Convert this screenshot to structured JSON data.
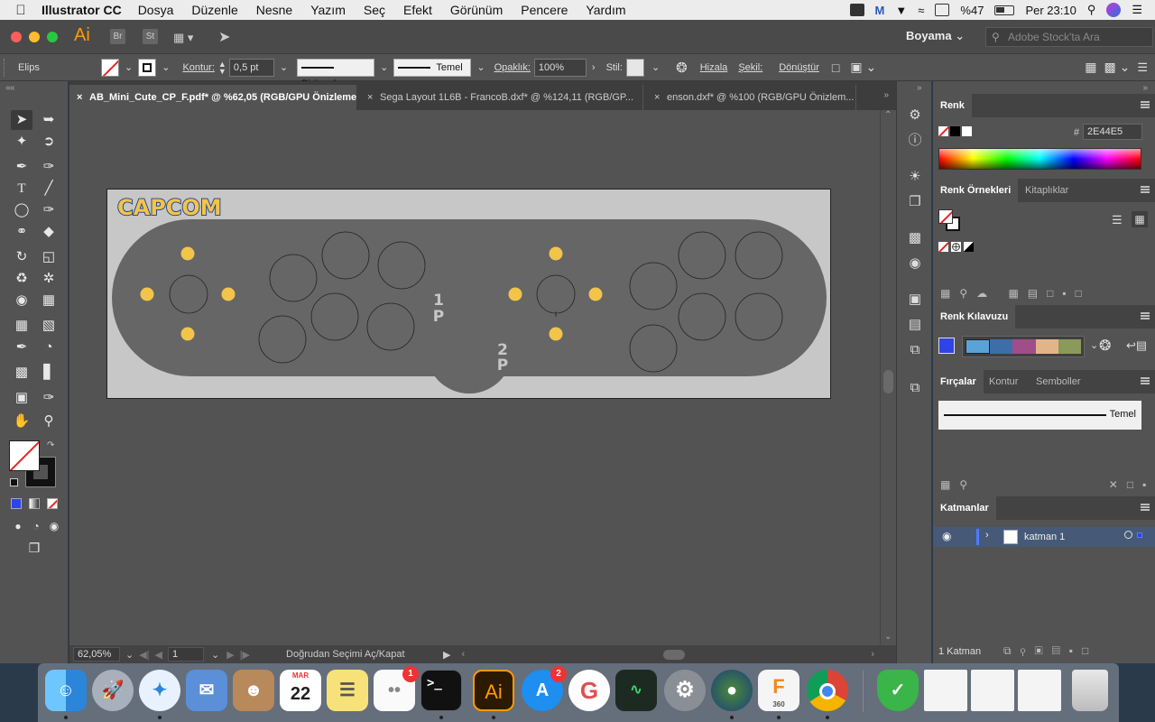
{
  "menubar": {
    "app_name": "Illustrator CC",
    "menus": [
      "Dosya",
      "Düzenle",
      "Nesne",
      "Yazım",
      "Seç",
      "Efekt",
      "Görünüm",
      "Pencere",
      "Yardım"
    ],
    "battery": "%47",
    "clock": "Per 23:10"
  },
  "appbar": {
    "logo": "Ai",
    "bridge_label": "Br",
    "stock_label": "St",
    "workspace": "Boyama",
    "stock_search_placeholder": "Adobe Stock'ta Ara"
  },
  "control": {
    "object_type": "Elips",
    "stroke_label": "Kontur:",
    "stroke_weight": "0,5 pt",
    "profile": "Birörnek",
    "brush": "Temel",
    "opacity_label": "Opaklık:",
    "opacity": "100%",
    "style_label": "Stil:",
    "align_label": "Hizala",
    "shape_label": "Şekil:",
    "transform_label": "Dönüştür"
  },
  "tabs": [
    {
      "label": "AB_Mini_Cute_CP_F.pdf* @ %62,05 (RGB/GPU Önizleme)",
      "close": "×"
    },
    {
      "label": "Sega Layout 1L6B - FrancoB.dxf* @ %124,11 (RGB/GP...",
      "close": "×"
    },
    {
      "label": "enson.dxf* @ %100 (RGB/GPU Önizlem...",
      "close": "×"
    }
  ],
  "artboard": {
    "logo_text": "CAPCOM",
    "player1_num": "1",
    "player1_letter": "P",
    "player2_num": "2",
    "player2_letter": "P",
    "panel_color": "#666666",
    "dot_color": "#f2c44a",
    "board_color": "#c7c7c7"
  },
  "status": {
    "zoom": "62,05%",
    "page": "1",
    "message": "Doğrudan Seçimi Aç/Kapat"
  },
  "panels": {
    "color": {
      "title": "Renk",
      "hash": "#",
      "hex": "2E44E5"
    },
    "swatches": {
      "tab1": "Renk Örnekleri",
      "tab2": "Kitaplıklar"
    },
    "color_guide": {
      "title": "Renk Kılavuzu",
      "base_color": "#2e44e5",
      "harmony": [
        "#5aa3d8",
        "#3d6ea8",
        "#a04d8a",
        "#e3b48a",
        "#8a9a5a"
      ]
    },
    "brushes": {
      "tab1": "Fırçalar",
      "tab2": "Kontur",
      "tab3": "Semboller",
      "brush_name": "Temel"
    },
    "layers": {
      "title": "Katmanlar",
      "layer_name": "katman 1",
      "count": "1 Katman"
    }
  },
  "dock": {
    "ai_label": "Ai",
    "mail_badge": "1",
    "appstore_badge": "2",
    "calendar_month": "MAR",
    "calendar_day": "22",
    "terminal_prompt": ">_",
    "fusion_label": "F",
    "fusion_sub": "360",
    "grammarly_label": "G"
  }
}
